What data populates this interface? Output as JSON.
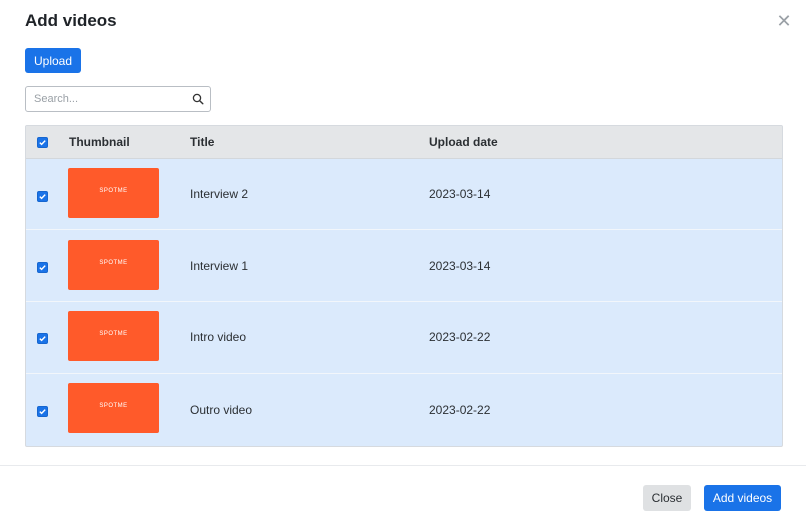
{
  "dialog": {
    "title": "Add videos",
    "close_icon": "close-icon"
  },
  "toolbar": {
    "upload_label": "Upload"
  },
  "search": {
    "placeholder": "Search...",
    "value": "",
    "icon": "search-icon"
  },
  "table": {
    "select_all_checked": true,
    "headers": {
      "thumbnail": "Thumbnail",
      "title": "Title",
      "upload_date": "Upload date"
    },
    "thumbnail_color": "#ff5a2a",
    "thumbnail_logo_text": "SPOTME",
    "rows": [
      {
        "checked": true,
        "title": "Interview 2",
        "upload_date": "2023-03-14"
      },
      {
        "checked": true,
        "title": "Interview 1",
        "upload_date": "2023-03-14"
      },
      {
        "checked": true,
        "title": "Intro video",
        "upload_date": "2023-02-22"
      },
      {
        "checked": true,
        "title": "Outro video",
        "upload_date": "2023-02-22"
      }
    ]
  },
  "footer": {
    "close_label": "Close",
    "add_label": "Add videos"
  },
  "colors": {
    "primary": "#1a73e8",
    "selected_row": "#dbeafc",
    "header_bg": "#e4e6e8"
  }
}
